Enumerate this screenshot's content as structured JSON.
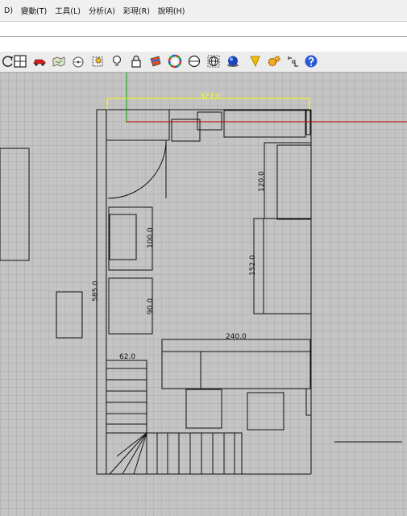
{
  "menu": {
    "items": [
      "D)",
      "變動(T)",
      "工具(L)",
      "分析(A)",
      "彩現(R)",
      "說明(H)"
    ]
  },
  "toolbar": {
    "buttons": [
      "rotate-view-icon",
      "four-viewports-icon",
      "car-icon",
      "map-icon",
      "target-icon",
      "bulb-frame-icon",
      "lightbulb-icon",
      "lock-icon",
      "paint-bucket-icon",
      "color-wheel-icon",
      "sphere-icon",
      "sphere-wire-icon",
      "blue-sphere-icon",
      "warning-cone-icon",
      "gears-icon",
      "snap-icon",
      "help-icon"
    ]
  },
  "drawing": {
    "dimensions": {
      "top_width": "327.0",
      "left_height": "585.0",
      "cabinet_upper": "100.0",
      "cabinet_lower": "90.0",
      "right_upper": "120.0",
      "right_lower": "152.0",
      "counter_width": "240.0",
      "stair_width": "62.0"
    },
    "colors": {
      "background": "#c4c4c4",
      "grid": "#b6b6b6",
      "lines": "#111111",
      "dimension_highlight": "#ffff00",
      "x_axis": "#c00000",
      "y_axis": "#00a000"
    }
  }
}
